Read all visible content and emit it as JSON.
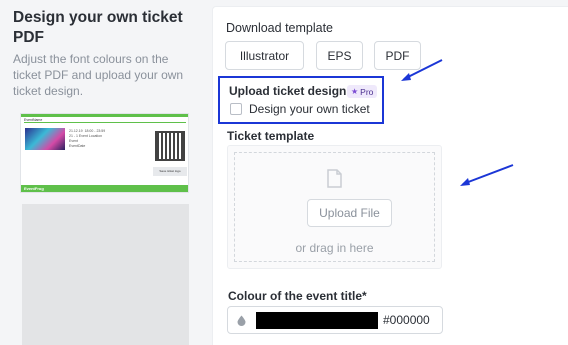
{
  "sidebar": {
    "title": "Design your own ticket PDF",
    "description": "Adjust the font colours on the ticket PDF and upload your own ticket design."
  },
  "ticket_preview": {
    "event_name": "EventName",
    "info_lines": "21.12.19  18:00 - 23:59\n21 - 1 Event Location\nEvent\nEventDate",
    "button_label": "Save ticket logo",
    "brand": "EventFrog",
    "colors": {
      "accent": "#5fc04a"
    }
  },
  "download": {
    "title": "Download template",
    "buttons": [
      "Illustrator",
      "EPS",
      "PDF"
    ]
  },
  "upload_design": {
    "title": "Upload ticket design",
    "pro_badge": "Pro",
    "checkbox_label": "Design your own ticket",
    "checked": false
  },
  "ticket_template": {
    "title": "Ticket template",
    "upload_button": "Upload File",
    "drag_text": "or drag in here"
  },
  "event_title_colour": {
    "title": "Colour of the event title*",
    "value": "#000000",
    "swatch_color": "#000000"
  },
  "annotations": {
    "highlight_color": "#1b36d6",
    "arrow_color": "#1b36d6"
  }
}
